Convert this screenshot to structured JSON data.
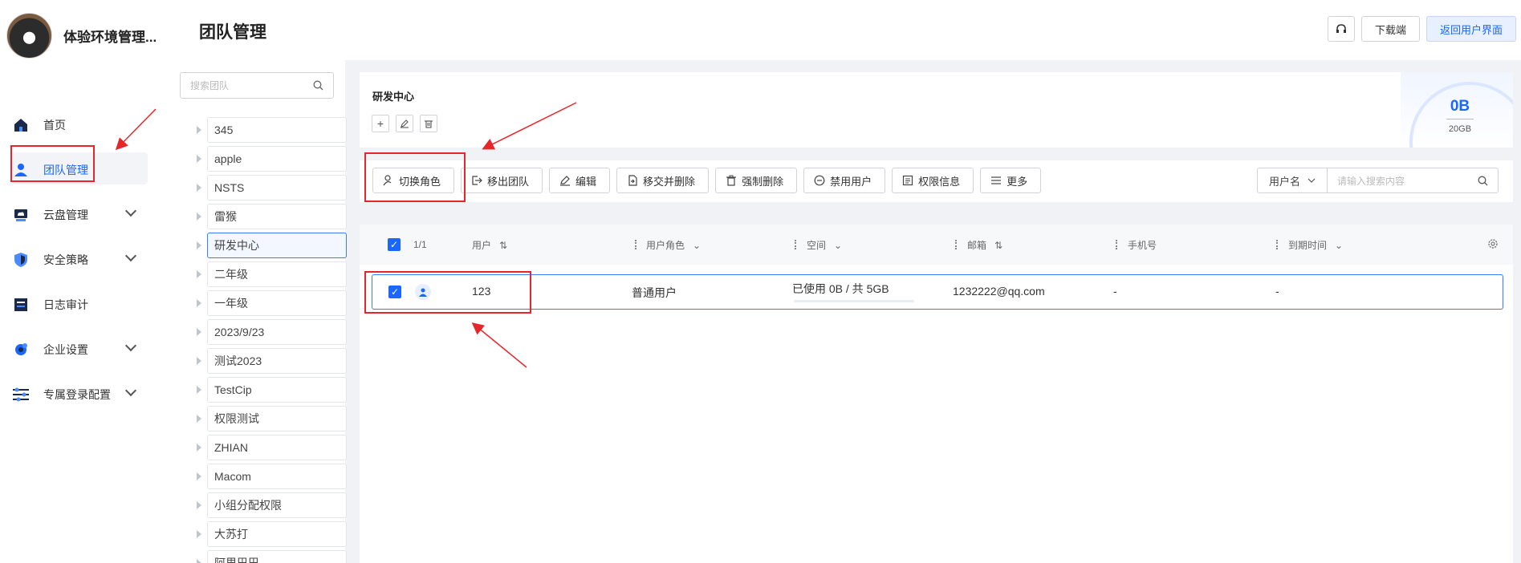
{
  "sidebar": {
    "brand_name": "体验环境管理...",
    "items": [
      {
        "label": "首页",
        "icon": "home-icon"
      },
      {
        "label": "团队管理",
        "icon": "user-icon",
        "active": true
      },
      {
        "label": "云盘管理",
        "icon": "cloud-disk-icon",
        "expandable": true
      },
      {
        "label": "安全策略",
        "icon": "shield-icon",
        "expandable": true
      },
      {
        "label": "日志审计",
        "icon": "log-icon"
      },
      {
        "label": "企业设置",
        "icon": "settings-gear-icon",
        "expandable": true
      },
      {
        "label": "专属登录配置",
        "icon": "sliders-icon",
        "expandable": true
      }
    ]
  },
  "header": {
    "title": "团队管理",
    "headset_icon": "headset-icon",
    "download_label": "下载端",
    "back_label": "返回用户界面"
  },
  "teams": {
    "search_placeholder": "搜索团队",
    "items": [
      "345",
      "apple",
      "NSTS",
      "雷猴",
      "研发中心",
      "二年级",
      "一年级",
      "2023/9/23",
      "测试2023",
      "TestCip",
      "权限测试",
      "ZHIAN",
      "Macom",
      "小组分配权限",
      "大苏打",
      "阿里巴巴"
    ],
    "selected": "研发中心"
  },
  "team_info": {
    "name": "研发中心",
    "used": "0B",
    "total": "20GB",
    "actions": [
      "add-icon",
      "edit-icon",
      "delete-icon"
    ]
  },
  "toolbar": {
    "buttons": [
      {
        "label": "切换角色",
        "icon": "switch-role-icon"
      },
      {
        "label": "移出团队",
        "icon": "remove-team-icon"
      },
      {
        "label": "编辑",
        "icon": "edit-icon"
      },
      {
        "label": "移交并删除",
        "icon": "transfer-icon"
      },
      {
        "label": "强制删除",
        "icon": "trash-icon"
      },
      {
        "label": "禁用用户",
        "icon": "disable-icon"
      },
      {
        "label": "权限信息",
        "icon": "permission-icon"
      },
      {
        "label": "更多",
        "icon": "list-icon"
      }
    ],
    "filter_field": "用户名",
    "search_placeholder": "请输入搜索内容"
  },
  "table": {
    "selection_count": "1/1",
    "columns": [
      "用户",
      "用户角色",
      "空间",
      "邮箱",
      "手机号",
      "到期时间"
    ],
    "rows": [
      {
        "user": "123",
        "role": "普通用户",
        "space": "已使用 0B / 共 5GB",
        "email": "1232222@qq.com",
        "phone": "-",
        "expire": "-"
      }
    ]
  },
  "colors": {
    "primary": "#1a66ff",
    "highlight": "#e8262a"
  }
}
